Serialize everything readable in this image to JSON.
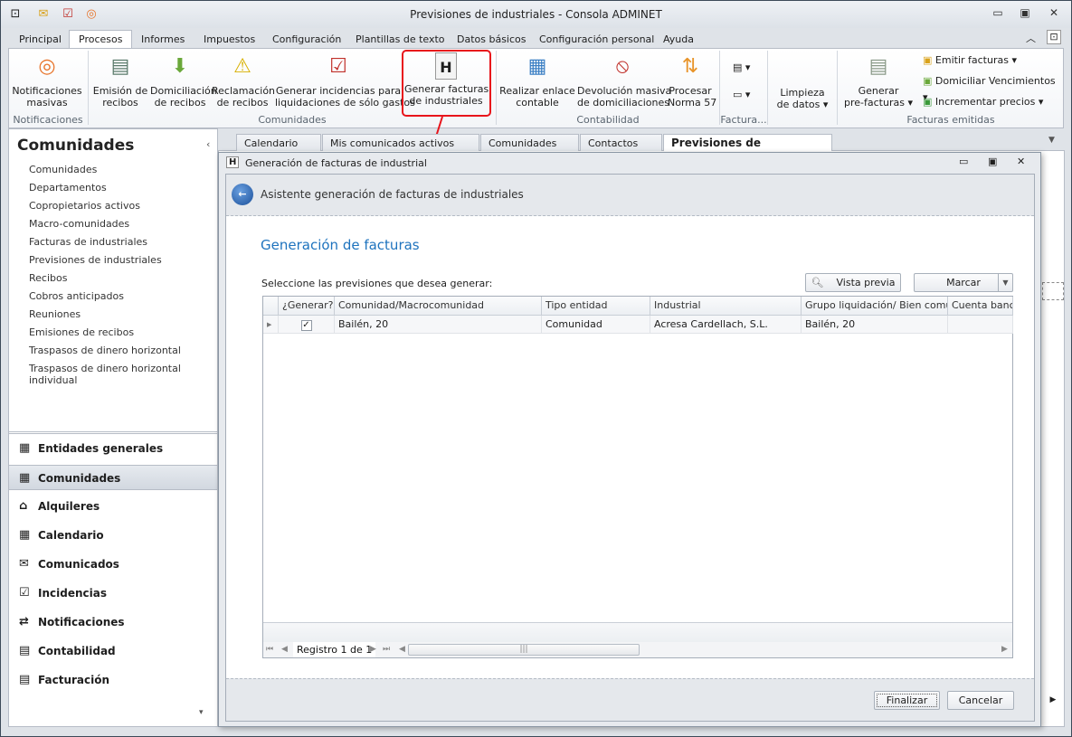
{
  "window": {
    "title": "Previsiones de industriales - Consola ADMINET"
  },
  "quick_access": [
    "app-icon",
    "mail-icon",
    "clipboard-icon",
    "broadcast-icon"
  ],
  "ribbon_tabs": [
    {
      "label": "Principal"
    },
    {
      "label": "Procesos",
      "selected": true
    },
    {
      "label": "Informes"
    },
    {
      "label": "Impuestos"
    },
    {
      "label": "Configuración"
    },
    {
      "label": "Plantillas de texto"
    },
    {
      "label": "Datos básicos"
    },
    {
      "label": "Configuración personal"
    },
    {
      "label": "Ayuda"
    }
  ],
  "ribbon": {
    "notificaciones": {
      "group": "Notificaciones",
      "masivas": "Notificaciones\nmasivas"
    },
    "comunidades": {
      "group": "Comunidades",
      "emision": "Emisión de\nrecibos",
      "domiciliacion": "Domiciliación\nde recibos",
      "reclamacion": "Reclamación\nde recibos",
      "incidencias": "Generar incidencias para\nliquidaciones de sólo gastos",
      "facturas_ind": "Generar facturas\nde industriales"
    },
    "contabilidad": {
      "group": "Contabilidad",
      "enlace": "Realizar enlace\ncontable",
      "devolucion": "Devolución masiva\nde domiciliaciones",
      "norma57": "Procesar\nNorma 57"
    },
    "factura": {
      "group": "Factura..."
    },
    "limpieza": "Limpieza\nde datos ▾",
    "emitidas": {
      "group": "Facturas emitidas",
      "prefacturas": "Generar\npre-facturas ▾",
      "emitir": "Emitir facturas ▾",
      "domiciliar": "Domiciliar Vencimientos ▾",
      "incrementar": "Incrementar precios ▾"
    }
  },
  "left_panel": {
    "title": "Comunidades",
    "items": [
      "Comunidades",
      "Departamentos",
      "Copropietarios activos",
      "Macro-comunidades",
      "Facturas de industriales",
      "Previsiones de industriales",
      "Recibos",
      "Cobros anticipados",
      "Reuniones",
      "Emisiones de recibos",
      "Traspasos de dinero horizontal",
      "Traspasos de dinero horizontal individual"
    ],
    "nav": [
      {
        "label": "Entidades generales",
        "icon": "▦"
      },
      {
        "label": "Comunidades",
        "icon": "▦",
        "selected": true
      },
      {
        "label": "Alquileres",
        "icon": "⌂"
      },
      {
        "label": "Calendario",
        "icon": "▦"
      },
      {
        "label": "Comunicados",
        "icon": "✉"
      },
      {
        "label": "Incidencias",
        "icon": "☑"
      },
      {
        "label": "Notificaciones",
        "icon": "⇄"
      },
      {
        "label": "Contabilidad",
        "icon": "▤"
      },
      {
        "label": "Facturación",
        "icon": "▤"
      }
    ]
  },
  "doc_tabs": [
    {
      "label": "Calendario"
    },
    {
      "label": "Mis comunicados activos"
    },
    {
      "label": "Comunidades"
    },
    {
      "label": "Contactos"
    },
    {
      "label": "Previsiones de industriales",
      "selected": true
    }
  ],
  "dialog": {
    "title": "Generación de facturas de industrial",
    "wizard_title": "Asistente generación de facturas de industriales",
    "heading": "Generación de facturas",
    "prompt": "Seleccione las previsiones que desea generar:",
    "vista_previa": "Vista previa",
    "marcar": "Marcar",
    "columns": [
      "¿Generar?",
      "Comunidad/Macrocomunidad",
      "Tipo entidad",
      "Industrial",
      "Grupo liquidación/ Bien común",
      "Cuenta banca"
    ],
    "rows": [
      {
        "generar": true,
        "comunidad": "Bailén, 20",
        "tipo": "Comunidad",
        "industrial": "Acresa Cardellach, S.L.",
        "grupo": "Bailén, 20",
        "cuenta": ""
      }
    ],
    "record": "Registro 1 de 1",
    "finalizar": "Finalizar",
    "cancelar": "Cancelar"
  },
  "colors": {
    "accent_heading": "#1e73be",
    "highlight": "#e8141b"
  }
}
